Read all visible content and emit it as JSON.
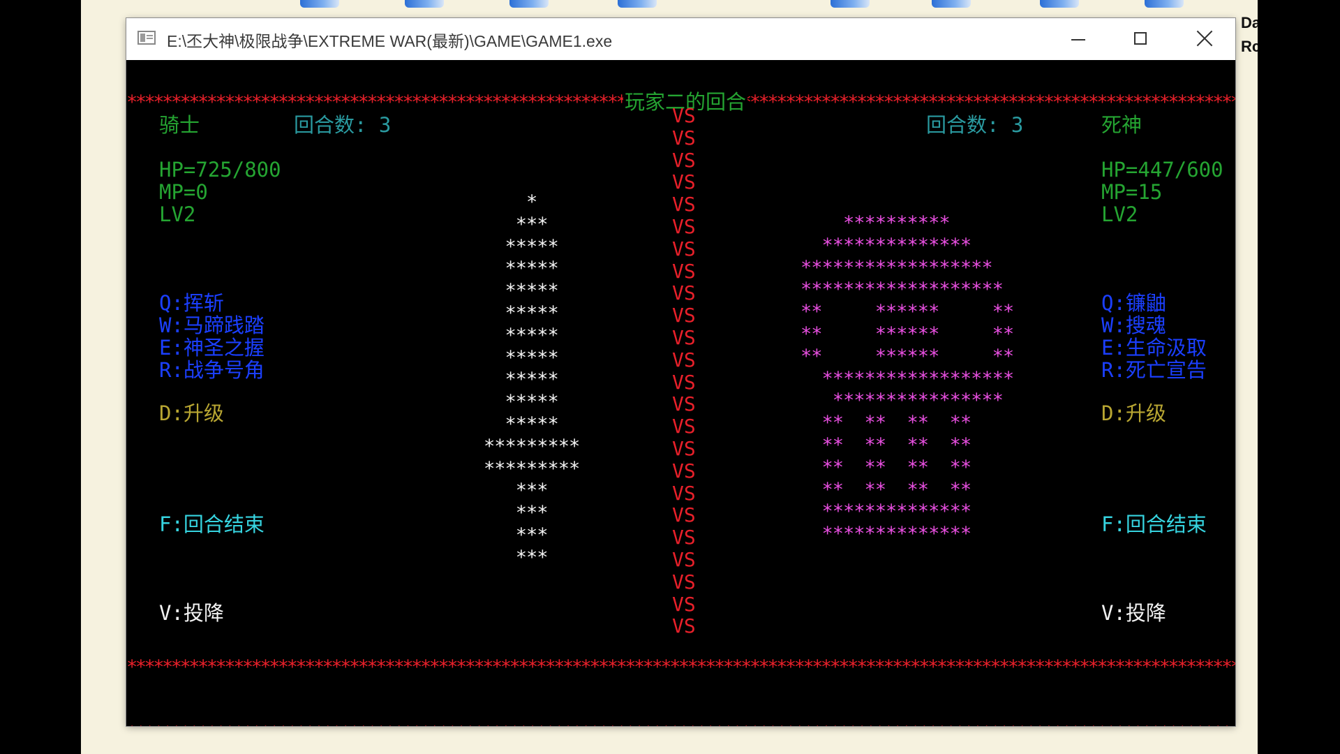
{
  "window": {
    "title": "E:\\丕大神\\极限战争\\EXTREME WAR(最新)\\GAME\\GAME1.exe"
  },
  "desktop": {
    "edge_text": [
      "Da",
      "Rc"
    ]
  },
  "console": {
    "banner_title": "玩家二的回合",
    "vs_label": "VS",
    "vs_count": 24,
    "player1": {
      "name": "骑士",
      "round": "回合数: 3",
      "hp": "HP=725/800",
      "mp": "MP=0",
      "level": "LV2",
      "skills": {
        "q": "Q:挥斩",
        "w": "W:马蹄践踏",
        "e": "E:神圣之握",
        "r": "R:战争号角"
      },
      "upgrade": "D:升级",
      "end_turn": "F:回合结束",
      "surrender": "V:投降"
    },
    "player2": {
      "name": "死神",
      "round": "回合数: 3",
      "hp": "HP=447/600",
      "mp": "MP=15",
      "level": "LV2",
      "skills": {
        "q": "Q:镰鼬",
        "w": "W:搜魂",
        "e": "E:生命汲取",
        "r": "R:死亡宣告"
      },
      "upgrade": "D:升级",
      "end_turn": "F:回合结束",
      "surrender": "V:投降"
    },
    "knight_art": "    *\n   ***\n  *****\n  *****\n  *****\n  *****\n  *****\n  *****\n  *****\n  *****\n  *****\n*********\n*********\n   ***\n   ***\n   ***\n   ***",
    "death_art": "    **********\n  **************\n******************\n*******************\n**     ******     **\n**     ******     **\n**     ******     **\n  ******************\n   ****************\n  **  **  **  **\n  **  **  **  **\n  **  **  **  **\n  **  **  **  **\n  **************\n  **************"
  },
  "colors": {
    "border_stars": "#e8202a",
    "player_name": "#25a532",
    "stats": "#25a532",
    "round": "#2a9aa0",
    "skills": "#1b3fff",
    "upgrade": "#b8a632",
    "end_turn": "#36d4e0",
    "surrender": "#f2f2f2",
    "knight_art": "#f2f2f2",
    "death_art": "#e84fe0",
    "desktop_bg": "#f6f2df"
  }
}
